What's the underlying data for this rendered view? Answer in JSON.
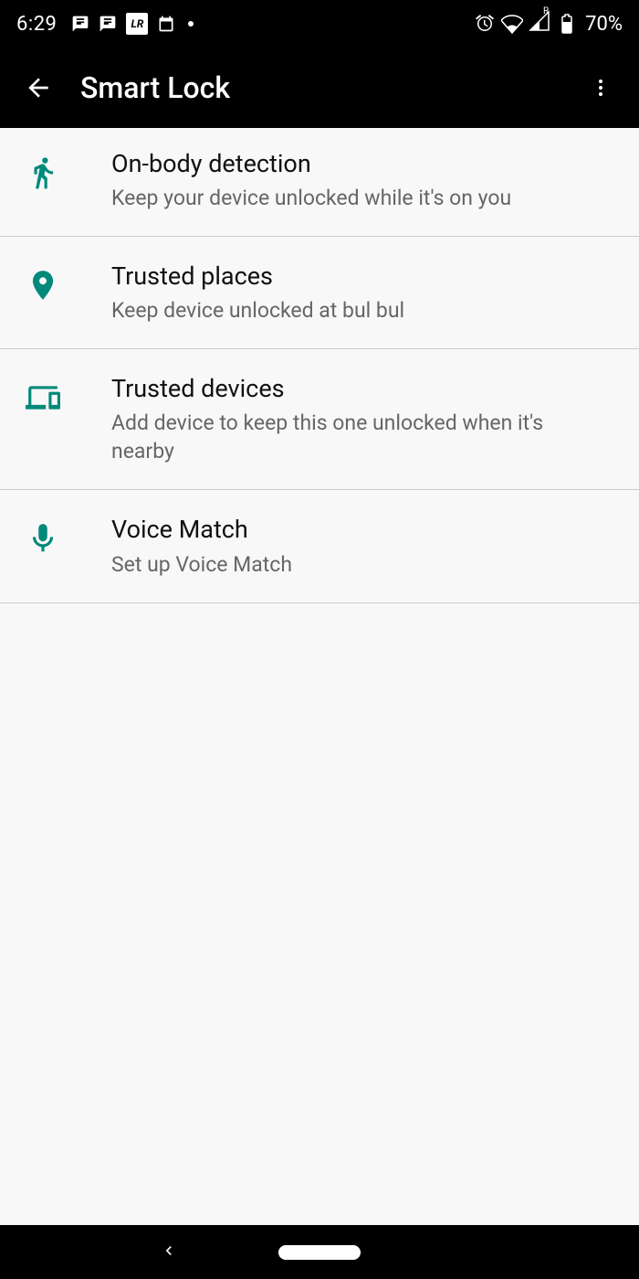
{
  "status": {
    "time": "6:29",
    "battery": "70%"
  },
  "header": {
    "title": "Smart Lock"
  },
  "items": [
    {
      "title": "On-body detection",
      "sub": "Keep your device unlocked while it's on you"
    },
    {
      "title": "Trusted places",
      "sub": "Keep device unlocked at bul bul"
    },
    {
      "title": "Trusted devices",
      "sub": "Add device to keep this one unlocked when it's nearby"
    },
    {
      "title": "Voice Match",
      "sub": "Set up Voice Match"
    }
  ]
}
